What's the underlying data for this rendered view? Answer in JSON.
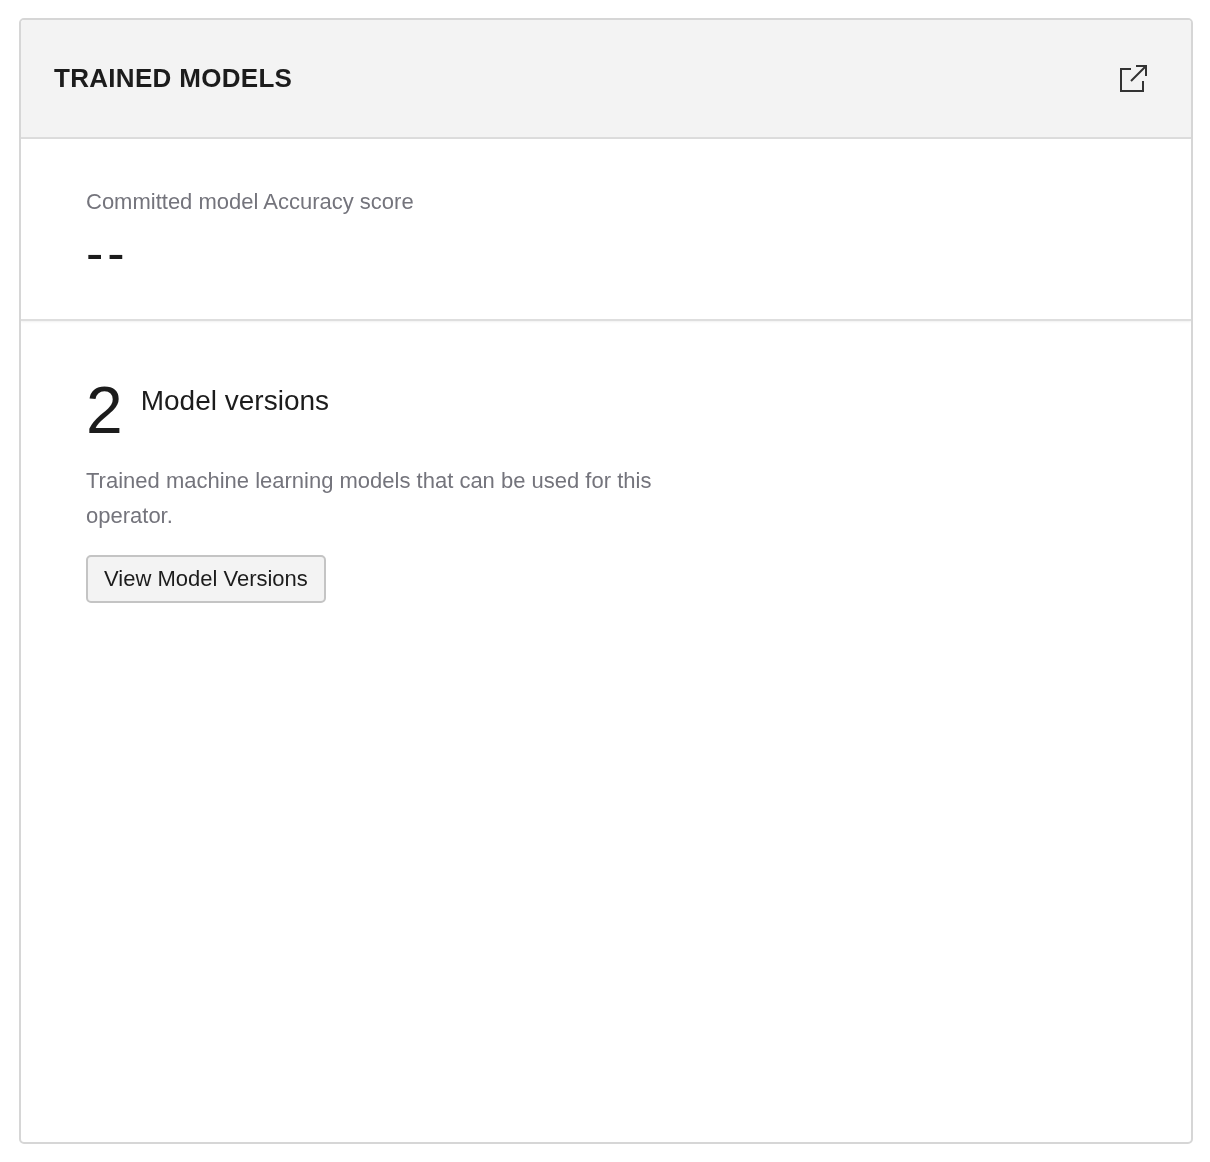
{
  "card": {
    "title": "TRAINED MODELS"
  },
  "score": {
    "label": "Committed model Accuracy score",
    "value": "--"
  },
  "versions": {
    "count": "2",
    "label": "Model versions",
    "description": "Trained machine learning models that can be used for this operator.",
    "button": "View Model Versions"
  }
}
